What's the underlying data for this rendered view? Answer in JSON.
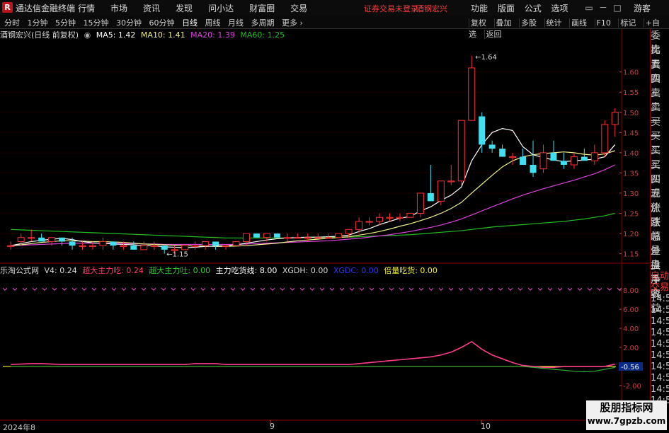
{
  "app": {
    "logo": "R",
    "name": "通达信金融终端",
    "notice": "证券交易未登录",
    "stock": "酒钢宏兴",
    "guest": "游客"
  },
  "menu": [
    "行情",
    "市场",
    "资讯",
    "发现",
    "问小达",
    "财富圈",
    "交易"
  ],
  "right_menu": [
    "功能",
    "版面",
    "公式",
    "选项"
  ],
  "window_controls": [
    "▭",
    "－",
    "□",
    "×"
  ],
  "toolbar": {
    "periods": [
      "分时",
      "1分钟",
      "5分钟",
      "15分钟",
      "30分钟",
      "60分钟",
      "日线",
      "周线",
      "月线",
      "多周期",
      "更多 ›"
    ],
    "active": "日线",
    "right": [
      "复权",
      "叠加",
      "多股",
      "统计",
      "画线",
      "F10",
      "标记",
      "+自选",
      "返回"
    ]
  },
  "info": {
    "title": "酒钢宏兴(日线 前复权)",
    "ma5": "MA5: 1.42",
    "ma10": "MA10: 1.41",
    "ma20": "MA20: 1.39",
    "ma60": "MA60: 1.25"
  },
  "indicator": {
    "name": "乐淘公式网",
    "v4": "V4: 0.24",
    "a": "超大主力吃: 0.24",
    "b": "超大主力吐: 0.00",
    "c": "主力吃货线: 8.00",
    "d": "XGDH: 0.00",
    "e": "XGDC: 0.00",
    "f": "倍量吃货: 0.00"
  },
  "price_axis": [
    "1.60",
    "1.55",
    "1.50",
    "1.45",
    "1.40",
    "1.35",
    "1.30",
    "1.25",
    "1.20",
    "1.15"
  ],
  "ind_axis": [
    "8.00",
    "6.00",
    "4.00",
    "2.00",
    "0.00",
    "-2.00",
    "-4.00"
  ],
  "ind_current": "-0.56",
  "annotations": {
    "high": "1.64",
    "low": "1.15"
  },
  "sidebar": [
    "委比",
    "卖五",
    "卖四",
    "卖三",
    "卖二",
    "卖一",
    "买一",
    "买二",
    "买三",
    "买四",
    "买五",
    "现价",
    "涨跌",
    "涨幅",
    "总量",
    "外盘",
    "换手",
    "净资",
    "收益"
  ],
  "sidebar2": [
    "自动",
    "交易",
    "14:5",
    "14:5",
    "14:5",
    "14:5",
    "14:5",
    "14:5",
    "14:5",
    "14:5",
    "14:5",
    "14:5"
  ],
  "dates": {
    "d1": "2024年8",
    "d2": "9",
    "d3": "10"
  },
  "watermark": {
    "line1": "股朋指标网",
    "line2": "www.7gpzb.com"
  },
  "colors": {
    "up": "#ff3030",
    "down": "#40e0f0",
    "ma5": "#ffffff",
    "ma10": "#f0f08c",
    "ma20": "#e040e0",
    "ma60": "#20c020"
  },
  "chart_data": {
    "type": "candlestick",
    "candles": [
      [
        1.17,
        1.18,
        1.16,
        1.17
      ],
      [
        1.18,
        1.2,
        1.17,
        1.19
      ],
      [
        1.19,
        1.21,
        1.18,
        1.19
      ],
      [
        1.19,
        1.2,
        1.18,
        1.18
      ],
      [
        1.18,
        1.19,
        1.17,
        1.19
      ],
      [
        1.19,
        1.19,
        1.17,
        1.18
      ],
      [
        1.18,
        1.19,
        1.16,
        1.17
      ],
      [
        1.17,
        1.18,
        1.16,
        1.17
      ],
      [
        1.17,
        1.18,
        1.16,
        1.17
      ],
      [
        1.17,
        1.19,
        1.16,
        1.18
      ],
      [
        1.18,
        1.18,
        1.16,
        1.17
      ],
      [
        1.17,
        1.18,
        1.16,
        1.17
      ],
      [
        1.17,
        1.18,
        1.16,
        1.16
      ],
      [
        1.16,
        1.18,
        1.16,
        1.17
      ],
      [
        1.17,
        1.18,
        1.16,
        1.17
      ],
      [
        1.17,
        1.17,
        1.15,
        1.16
      ],
      [
        1.16,
        1.17,
        1.15,
        1.16
      ],
      [
        1.16,
        1.17,
        1.16,
        1.17
      ],
      [
        1.17,
        1.18,
        1.16,
        1.17
      ],
      [
        1.17,
        1.18,
        1.16,
        1.18
      ],
      [
        1.18,
        1.18,
        1.16,
        1.17
      ],
      [
        1.17,
        1.17,
        1.16,
        1.17
      ],
      [
        1.17,
        1.18,
        1.17,
        1.18
      ],
      [
        1.18,
        1.2,
        1.17,
        1.2
      ],
      [
        1.2,
        1.2,
        1.19,
        1.19
      ],
      [
        1.19,
        1.2,
        1.18,
        1.2
      ],
      [
        1.2,
        1.2,
        1.19,
        1.19
      ],
      [
        1.19,
        1.2,
        1.18,
        1.19
      ],
      [
        1.19,
        1.2,
        1.19,
        1.19
      ],
      [
        1.19,
        1.2,
        1.18,
        1.19
      ],
      [
        1.19,
        1.2,
        1.19,
        1.19
      ],
      [
        1.19,
        1.2,
        1.19,
        1.19
      ],
      [
        1.19,
        1.2,
        1.19,
        1.2
      ],
      [
        1.2,
        1.21,
        1.19,
        1.21
      ],
      [
        1.21,
        1.24,
        1.2,
        1.23
      ],
      [
        1.23,
        1.24,
        1.22,
        1.23
      ],
      [
        1.23,
        1.25,
        1.22,
        1.24
      ],
      [
        1.24,
        1.25,
        1.23,
        1.24
      ],
      [
        1.24,
        1.25,
        1.23,
        1.24
      ],
      [
        1.24,
        1.25,
        1.24,
        1.25
      ],
      [
        1.25,
        1.3,
        1.24,
        1.3
      ],
      [
        1.3,
        1.37,
        1.29,
        1.28
      ],
      [
        1.28,
        1.33,
        1.27,
        1.33
      ],
      [
        1.33,
        1.37,
        1.32,
        1.33
      ],
      [
        1.33,
        1.43,
        1.32,
        1.48
      ],
      [
        1.48,
        1.64,
        1.48,
        1.61
      ],
      [
        1.49,
        1.5,
        1.4,
        1.42
      ],
      [
        1.42,
        1.43,
        1.4,
        1.41
      ],
      [
        1.41,
        1.42,
        1.39,
        1.39
      ],
      [
        1.39,
        1.4,
        1.37,
        1.39
      ],
      [
        1.39,
        1.41,
        1.38,
        1.37
      ],
      [
        1.37,
        1.43,
        1.34,
        1.35
      ],
      [
        1.36,
        1.42,
        1.35,
        1.4
      ],
      [
        1.4,
        1.43,
        1.38,
        1.38
      ],
      [
        1.38,
        1.4,
        1.36,
        1.37
      ],
      [
        1.37,
        1.4,
        1.36,
        1.39
      ],
      [
        1.39,
        1.41,
        1.38,
        1.38
      ],
      [
        1.38,
        1.42,
        1.37,
        1.4
      ],
      [
        1.4,
        1.48,
        1.39,
        1.47
      ],
      [
        1.47,
        1.51,
        1.44,
        1.5
      ]
    ],
    "ma5": [
      1.17,
      1.175,
      1.18,
      1.183,
      1.186,
      1.188,
      1.185,
      1.18,
      1.177,
      1.176,
      1.174,
      1.173,
      1.172,
      1.17,
      1.17,
      1.167,
      1.166,
      1.165,
      1.166,
      1.168,
      1.169,
      1.17,
      1.172,
      1.176,
      1.18,
      1.184,
      1.187,
      1.189,
      1.19,
      1.191,
      1.191,
      1.192,
      1.193,
      1.196,
      1.205,
      1.212,
      1.222,
      1.23,
      1.238,
      1.242,
      1.256,
      1.266,
      1.282,
      1.295,
      1.315,
      1.38,
      1.42,
      1.45,
      1.46,
      1.455,
      1.415,
      1.395,
      1.388,
      1.382,
      1.378,
      1.38,
      1.382,
      1.384,
      1.39,
      1.42
    ],
    "ma10": [
      1.17,
      1.172,
      1.175,
      1.178,
      1.18,
      1.182,
      1.182,
      1.181,
      1.18,
      1.18,
      1.179,
      1.178,
      1.176,
      1.174,
      1.173,
      1.172,
      1.171,
      1.17,
      1.169,
      1.169,
      1.168,
      1.168,
      1.169,
      1.17,
      1.172,
      1.174,
      1.176,
      1.179,
      1.182,
      1.184,
      1.186,
      1.188,
      1.19,
      1.192,
      1.196,
      1.2,
      1.205,
      1.211,
      1.218,
      1.224,
      1.232,
      1.24,
      1.25,
      1.262,
      1.277,
      1.3,
      1.322,
      1.344,
      1.365,
      1.38,
      1.39,
      1.395,
      1.398,
      1.4,
      1.402,
      1.4,
      1.396,
      1.394,
      1.397,
      1.405
    ],
    "ma20": [
      1.17,
      1.171,
      1.172,
      1.173,
      1.174,
      1.175,
      1.176,
      1.176,
      1.176,
      1.176,
      1.176,
      1.175,
      1.175,
      1.174,
      1.174,
      1.173,
      1.173,
      1.173,
      1.173,
      1.173,
      1.173,
      1.173,
      1.173,
      1.174,
      1.175,
      1.176,
      1.177,
      1.178,
      1.179,
      1.18,
      1.181,
      1.182,
      1.184,
      1.186,
      1.188,
      1.191,
      1.194,
      1.197,
      1.201,
      1.205,
      1.21,
      1.215,
      1.221,
      1.228,
      1.236,
      1.246,
      1.256,
      1.266,
      1.276,
      1.286,
      1.295,
      1.303,
      1.311,
      1.318,
      1.325,
      1.332,
      1.34,
      1.348,
      1.358,
      1.37
    ],
    "ma60": [
      1.21,
      1.209,
      1.208,
      1.207,
      1.206,
      1.205,
      1.204,
      1.203,
      1.202,
      1.201,
      1.2,
      1.199,
      1.198,
      1.197,
      1.196,
      1.195,
      1.194,
      1.193,
      1.192,
      1.191,
      1.19,
      1.189,
      1.189,
      1.189,
      1.189,
      1.189,
      1.189,
      1.189,
      1.189,
      1.19,
      1.19,
      1.19,
      1.191,
      1.191,
      1.192,
      1.193,
      1.194,
      1.195,
      1.196,
      1.197,
      1.199,
      1.201,
      1.203,
      1.205,
      1.207,
      1.21,
      1.213,
      1.216,
      1.218,
      1.22,
      1.222,
      1.224,
      1.226,
      1.228,
      1.23,
      1.233,
      1.236,
      1.24,
      1.244,
      1.25
    ],
    "ylim": [
      1.13,
      1.68
    ],
    "indicator": {
      "pink": [
        0.2,
        0.25,
        0.3,
        0.3,
        0.25,
        0.2,
        0.2,
        0.2,
        0.2,
        0.2,
        0.2,
        0.2,
        0.2,
        0.2,
        0.2,
        0.2,
        0.2,
        0.2,
        0.3,
        0.3,
        0.3,
        0.2,
        0.2,
        0.2,
        0.2,
        0.2,
        0.2,
        0.2,
        0.2,
        0.2,
        0.2,
        0.2,
        0.2,
        0.2,
        0.3,
        0.4,
        0.5,
        0.6,
        0.7,
        0.8,
        0.9,
        1.0,
        1.2,
        1.5,
        2.0,
        2.6,
        1.8,
        1.2,
        0.8,
        0.4,
        0.1,
        0.0,
        -0.1,
        -0.1,
        0.0,
        0.0,
        0.0,
        0.0,
        0.0,
        0.24
      ],
      "green": [
        0,
        0,
        0,
        0,
        0,
        0,
        0,
        0,
        0,
        0,
        0,
        0,
        0,
        0,
        0,
        0,
        0,
        0,
        0,
        0,
        0,
        0,
        0,
        0,
        0,
        0,
        0,
        0,
        0,
        0,
        0,
        0,
        0,
        0,
        0,
        0,
        0,
        0,
        0,
        0,
        0,
        0,
        0,
        0,
        0,
        0,
        0,
        0,
        0,
        0,
        0,
        -0.1,
        -0.2,
        -0.3,
        -0.4,
        -0.5,
        -0.56,
        -0.5,
        -0.3,
        -0.1
      ],
      "ylim": [
        -5.5,
        9.5
      ]
    }
  }
}
